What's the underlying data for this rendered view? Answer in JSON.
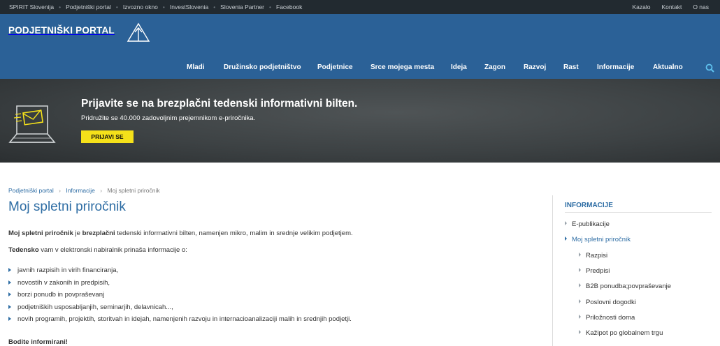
{
  "topbar": {
    "left_links": [
      "SPIRIT Slovenija",
      "Podjetniški portal",
      "Izvozno okno",
      "InvestSlovenia",
      "Slovenia Partner",
      "Facebook"
    ],
    "right_links": [
      "Kazalo",
      "Kontakt",
      "O nas"
    ]
  },
  "header": {
    "logo_text": "PODJETNIŠKI PORTAL",
    "nav": [
      "Mladi",
      "Družinsko podjetništvo",
      "Podjetnice",
      "Srce mojega mesta",
      "Ideja",
      "Zagon",
      "Razvoj",
      "Rast",
      "Informacije",
      "Aktualno"
    ],
    "search_icon": "search-icon"
  },
  "banner": {
    "title": "Prijavite se na brezplačni tedenski informativni bilten.",
    "subtitle": "Pridružite se 40.000 zadovoljnim prejemnikom e-priročnika.",
    "button": "PRIJAVI SE",
    "button_color": "#f5e11a",
    "icon": "laptop-envelope-icon"
  },
  "breadcrumb": {
    "items": [
      "Podjetniški portal",
      "Informacije",
      "Moj spletni priročnik"
    ]
  },
  "content": {
    "title": "Moj spletni priročnik",
    "p1_bold1": "Moj spletni priročnik",
    "p1_mid": " je ",
    "p1_bold2": "brezplačni",
    "p1_rest": " tedenski informativni bilten, namenjen mikro, malim in srednje velikim podjetjem.",
    "p2_bold": "Tedensko",
    "p2_rest": " vam v elektronski nabiralnik prinaša informacije o:",
    "bullets": [
      "javnih razpisih in virih financiranja,",
      "novostih v zakonih in predpisih,",
      "borzi ponudb in povpraševanj",
      "podjetniških usposabljanjih, seminarjih, delavnicah...,",
      "novih programih, projektih, storitvah in idejah, namenjenih razvoju in internacioanalizaciji malih in srednjih podjetji."
    ],
    "p3": "Bodite informirani!"
  },
  "sidebar": {
    "heading": "INFORMACIJE",
    "items": [
      "E-publikacije",
      "Moj spletni priročnik"
    ],
    "subitems": [
      "Razpisi",
      "Predpisi",
      "B2B ponudba;povpraševanje",
      "Poslovni dogodki",
      "Priložnosti doma",
      "Kažipot po globalnem trgu"
    ]
  },
  "colors": {
    "header_bg": "#2b6197",
    "topbar_bg": "#222a30",
    "link_blue": "#2e6da4"
  }
}
